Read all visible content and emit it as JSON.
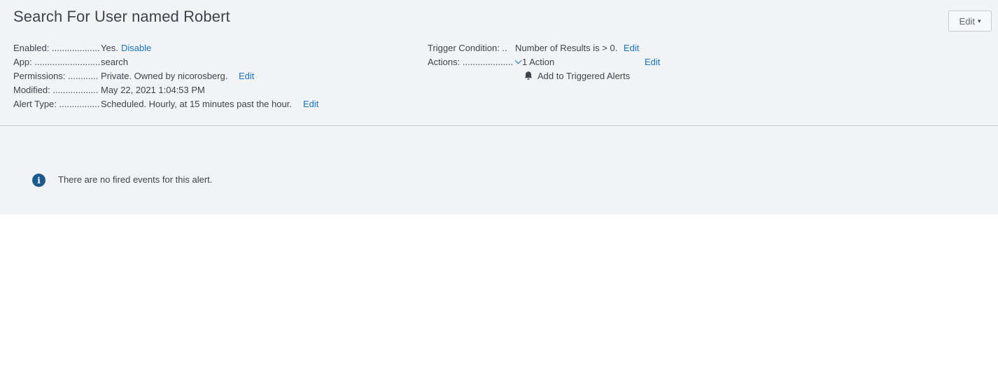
{
  "title": "Search For User named Robert",
  "edit_button": {
    "label": "Edit",
    "caret": "▾"
  },
  "details": {
    "enabled": {
      "label": "Enabled: ...................",
      "value": "Yes.",
      "link": "Disable"
    },
    "app": {
      "label": "App: ..........................",
      "value": "search"
    },
    "permissions": {
      "label": "Permissions: ............",
      "value": "Private. Owned by nicorosberg.",
      "link": "Edit"
    },
    "modified": {
      "label": "Modified: ..................",
      "value": "May 22, 2021 1:04:53 PM"
    },
    "alert_type": {
      "label": "Alert Type: ................",
      "value": "Scheduled. Hourly, at 15 minutes past the hour.",
      "link": "Edit"
    }
  },
  "trigger": {
    "condition": {
      "label": "Trigger Condition: ..",
      "value": "Number of Results is > 0.",
      "link": "Edit"
    },
    "actions": {
      "label": "Actions: ....................",
      "value": "1 Action",
      "link": "Edit",
      "items": [
        "Add to Triggered Alerts"
      ],
      "icon": "bell-icon"
    }
  },
  "events": {
    "message": "There are no fired events for this alert.",
    "icon": "info-icon",
    "icon_glyph": "i"
  },
  "colors": {
    "link": "#1a73b8",
    "panel": "#f2f3f5",
    "text": "#3c444d",
    "info_icon": "#1a5b8c"
  }
}
